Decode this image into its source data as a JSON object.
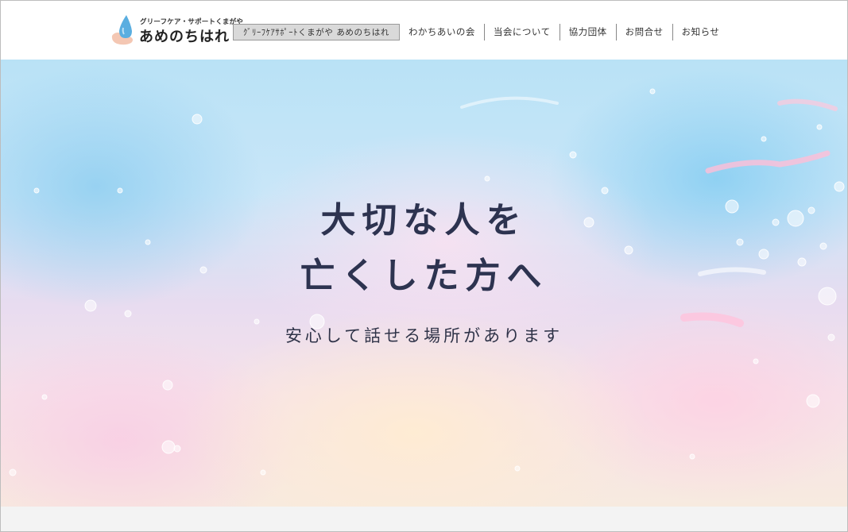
{
  "logo": {
    "tagline": "グリーフケア・サポートくまがや",
    "name": "あめのちはれ",
    "icon": "water-drop-icon"
  },
  "nav": {
    "items": [
      {
        "label": "ｸﾞﾘｰﾌｹｱｻﾎﾟｰﾄくまがや あめのちはれ",
        "active": true
      },
      {
        "label": "わかちあいの会",
        "active": false
      },
      {
        "label": "当会について",
        "active": false
      },
      {
        "label": "協力団体",
        "active": false
      },
      {
        "label": "お問合せ",
        "active": false
      },
      {
        "label": "お知らせ",
        "active": false
      }
    ]
  },
  "hero": {
    "title_line1": "大切な人を",
    "title_line2": "亡くした方へ",
    "subtitle": "安心して話せる場所があります"
  },
  "colors": {
    "title_text": "#2d3350",
    "nav_active_bg": "#d9d9d9",
    "logo_drop": "#5aaee0"
  }
}
